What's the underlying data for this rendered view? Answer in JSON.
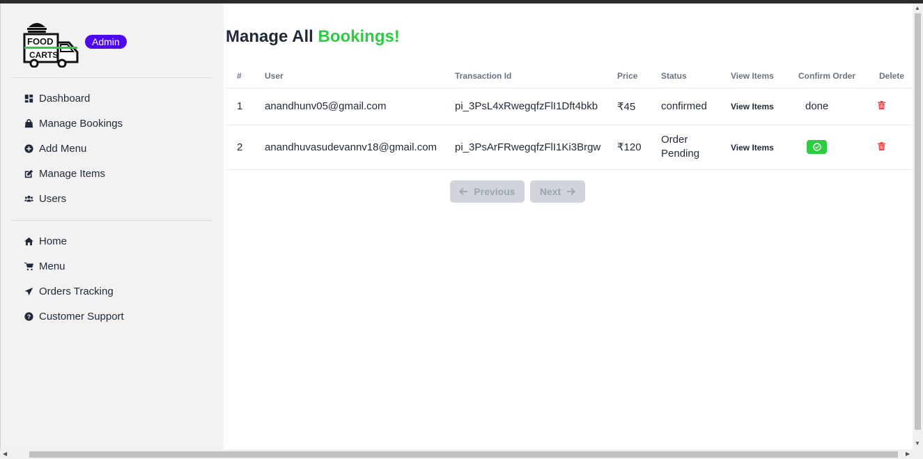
{
  "brand": {
    "logo_alt": "FOOD CARTS",
    "admin_badge": "Admin"
  },
  "sidebar": {
    "admin_items": [
      {
        "label": "Dashboard",
        "icon": "dashboard-icon"
      },
      {
        "label": "Manage Bookings",
        "icon": "shopping-bag-icon"
      },
      {
        "label": "Add Menu",
        "icon": "plus-circle-icon"
      },
      {
        "label": "Manage Items",
        "icon": "edit-icon"
      },
      {
        "label": "Users",
        "icon": "users-icon"
      }
    ],
    "site_items": [
      {
        "label": "Home",
        "icon": "home-icon"
      },
      {
        "label": "Menu",
        "icon": "cart-icon"
      },
      {
        "label": "Orders Tracking",
        "icon": "paper-plane-icon"
      },
      {
        "label": "Customer Support",
        "icon": "question-circle-icon"
      }
    ]
  },
  "page": {
    "title_prefix": "Manage All",
    "title_accent": "Bookings!"
  },
  "table": {
    "headers": [
      "#",
      "User",
      "Transaction Id",
      "Price",
      "Status",
      "View Items",
      "Confirm Order",
      "Delete"
    ],
    "rows": [
      {
        "index": "1",
        "user": "anandhunv05@gmail.com",
        "transaction_id": "pi_3PsL4xRwegqfzFlI1Dft4bkb",
        "price": "₹45",
        "status": "confirmed",
        "view_label": "View Items",
        "confirm": "done"
      },
      {
        "index": "2",
        "user": "anandhuvasudevannv18@gmail.com",
        "transaction_id": "pi_3PsArFRwegqfzFlI1Ki3Brgw",
        "price": "₹120",
        "status": "Order Pending",
        "view_label": "View Items",
        "confirm": "check-circle-icon"
      }
    ]
  },
  "pagination": {
    "previous_label": "Previous",
    "next_label": "Next"
  },
  "colors": {
    "accent_green": "#2ecc40",
    "badge_purple": "#4f06f0",
    "delete_red": "#ef4444",
    "disabled_gray": "#d1d5db"
  }
}
